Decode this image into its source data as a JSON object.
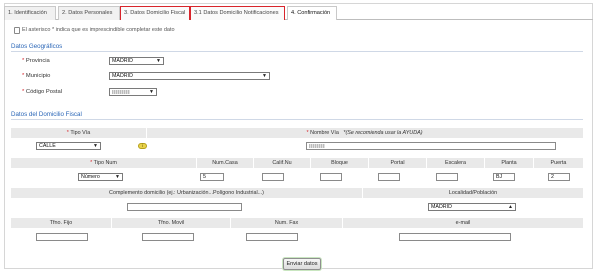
{
  "tabs": [
    {
      "label": "1. Identificación"
    },
    {
      "label": "2. Datos Personales"
    },
    {
      "label": "3. Datos Domicilio Fiscal"
    },
    {
      "label": "3.1 Datos Domicilio Notificaciones"
    },
    {
      "label": "4. Confirmación"
    }
  ],
  "note": {
    "star": "*",
    "text": "El asterisco * indica que es imprescindible completar este dato"
  },
  "geo": {
    "title": "Datos Geográficos",
    "provincia_label": "Provincia",
    "provincia_value": "MADRID",
    "municipio_label": "Municipio",
    "municipio_value": "MADRID",
    "cp_label": "Código Postal"
  },
  "fiscal": {
    "title": "Datos del Domicilio Fiscal",
    "tipo_via_label": "Tipo Vía",
    "tipo_via_value": "CALLE",
    "nombre_via_label": "Nombre Vía",
    "nombre_via_hint": "*(Se recomienda usar la AYUDA)",
    "help_icon": "help-icon",
    "tipo_num_label": "Tipo Num",
    "tipo_num_value": "Número",
    "cols": [
      "Num.Casa",
      "Calif.Nu",
      "Bloque",
      "Portal",
      "Escalera",
      "Planta",
      "Puerta"
    ],
    "num_casa_value": "5",
    "planta_value": "BJ",
    "puerta_value": "2",
    "complemento_label": "Complemento domicilio (ej.: Urbanización...Polígono Industrial...)",
    "localidad_label": "Localidad/Población",
    "localidad_value": "MADRID",
    "contact_cols": [
      "Tfno. Fijo",
      "Tfno. Movil",
      "Num. Fax",
      "e-mail"
    ]
  },
  "submit": {
    "label": "Enviar datos"
  },
  "colors": {
    "accent": "#2a66b7",
    "highlight": "#d8242b",
    "required": "#d8242b"
  }
}
